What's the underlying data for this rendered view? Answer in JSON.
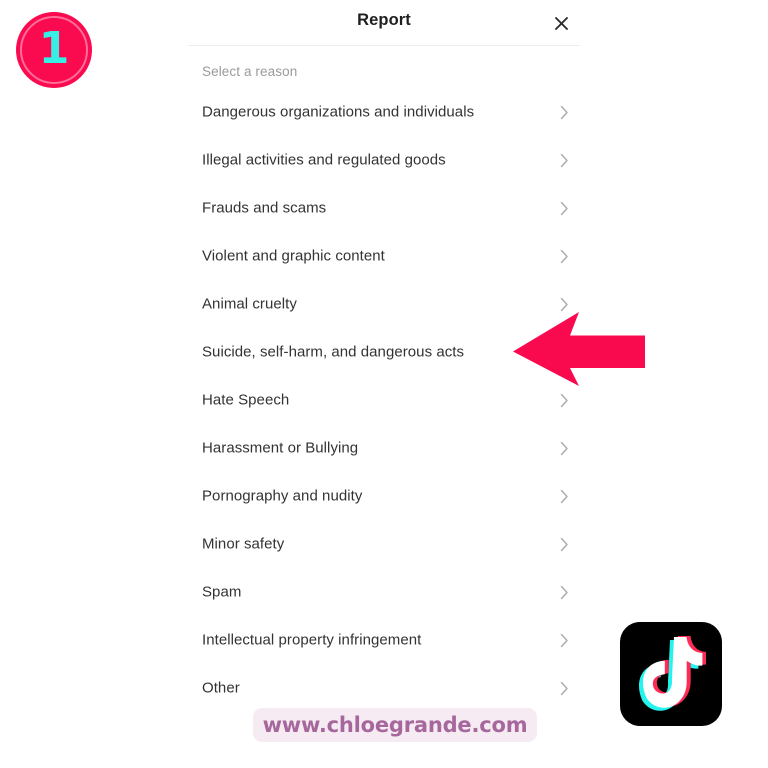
{
  "panel": {
    "title": "Report",
    "close_icon": "close-icon",
    "section_label": "Select a reason",
    "chevron_icon": "chevron-right-icon",
    "reasons": [
      {
        "label": "Dangerous organizations and individuals"
      },
      {
        "label": "Illegal activities and regulated goods"
      },
      {
        "label": "Frauds and scams"
      },
      {
        "label": "Violent and graphic content"
      },
      {
        "label": "Animal cruelty"
      },
      {
        "label": "Suicide, self-harm, and dangerous acts"
      },
      {
        "label": "Hate Speech"
      },
      {
        "label": "Harassment or Bullying"
      },
      {
        "label": "Pornography and nudity"
      },
      {
        "label": "Minor safety"
      },
      {
        "label": "Spam"
      },
      {
        "label": "Intellectual property infringement"
      },
      {
        "label": "Other"
      }
    ]
  },
  "annotations": {
    "step_badge_number": "1",
    "step_badge_color": "#fa0b50",
    "step_badge_number_color": "#35f0e5",
    "step_badge_ring_color": "#ff6d9b",
    "pointer_arrow_icon": "arrow-left-icon",
    "pointer_arrow_color": "#f9094e"
  },
  "branding": {
    "tiktok_logo_icon": "tiktok-logo-icon",
    "tiktok_logo_background": "#000000",
    "tiktok_accent_cyan": "#25f4ee",
    "tiktok_accent_pink": "#fe2c55",
    "watermark_text": "www.chloegrande.com",
    "watermark_text_color": "#a6689c",
    "watermark_background": "#f6ebf2"
  }
}
